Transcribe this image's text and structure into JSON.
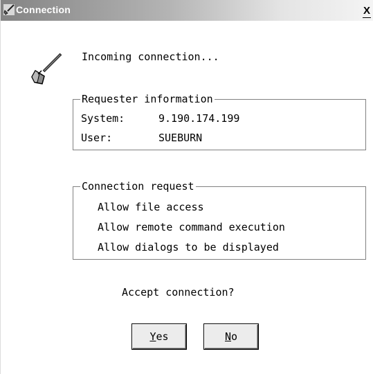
{
  "window": {
    "title": "Connection",
    "close_label": "X",
    "title_icon": "pen-tool-icon",
    "dialog_icon": "pen-tool-icon"
  },
  "message": "Incoming connection...",
  "requester": {
    "legend": "Requester information",
    "system_label": "System:",
    "system_value": "9.190.174.199",
    "user_label": "User:",
    "user_value": "SUEBURN"
  },
  "request": {
    "legend": "Connection request",
    "items": [
      "Allow file access",
      "Allow remote command execution",
      "Allow dialogs to be displayed"
    ]
  },
  "question": "Accept connection?",
  "buttons": {
    "yes_mnemonic": "Y",
    "yes_rest": "es",
    "no_mnemonic": "N",
    "no_rest": "o"
  }
}
